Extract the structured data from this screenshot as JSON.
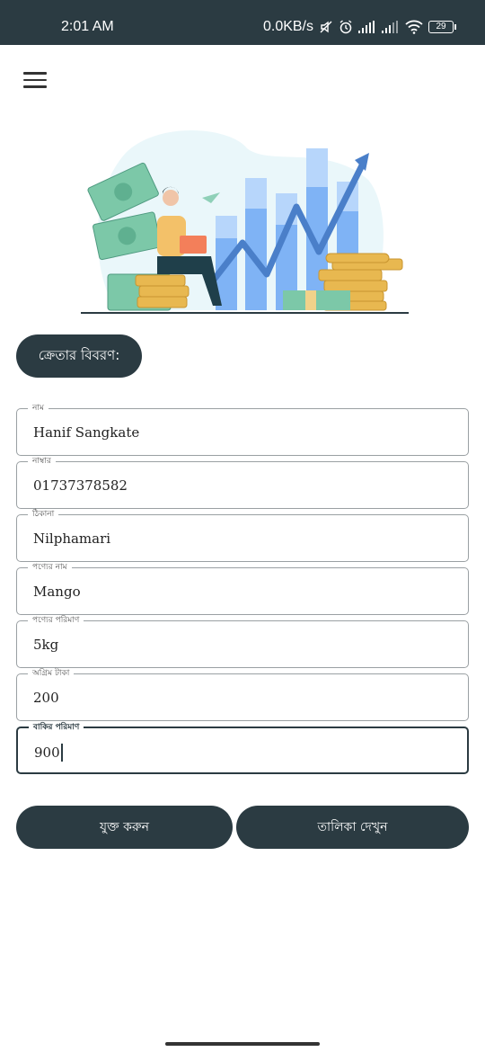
{
  "status_bar": {
    "time": "2:01 AM",
    "network_speed": "0.0KB/s",
    "battery": "29",
    "icons": [
      "mute-icon",
      "alarm-icon",
      "signal-icon",
      "signal-icon-2",
      "wifi-icon",
      "battery-icon"
    ]
  },
  "header": {
    "menu_icon": "hamburger-icon"
  },
  "section": {
    "customer_details_label": "ক্রেতার বিবরণ:"
  },
  "form": {
    "fields": [
      {
        "label": "নাম",
        "value": "Hanif Sangkate"
      },
      {
        "label": "নাম্বার",
        "value": "01737378582"
      },
      {
        "label": "ঠিকানা",
        "value": "Nilphamari"
      },
      {
        "label": "পণ্যের নাম",
        "value": "Mango"
      },
      {
        "label": "পণ্যের পরিমাণ",
        "value": "5kg"
      },
      {
        "label": "অগ্রিম টাকা",
        "value": "200"
      },
      {
        "label": "বাকির পরিমাণ",
        "value": "900"
      }
    ]
  },
  "actions": {
    "add_label": "যুক্ত করুন",
    "view_list_label": "তালিকা দেখুন"
  },
  "colors": {
    "primary": "#2b3b42",
    "chart_blue": "#7fb3f5",
    "chart_blue_light": "#b7d6fb",
    "coin": "#e8b850",
    "money": "#7cc8a8"
  }
}
